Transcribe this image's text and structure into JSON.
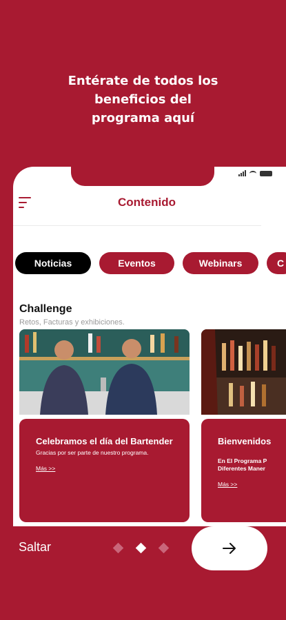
{
  "onboarding": {
    "headline_lines": [
      "Entérate de todos los",
      "beneficios del",
      "programa aquí"
    ],
    "skip_label": "Saltar",
    "current_page": 2,
    "total_pages": 3
  },
  "app": {
    "title": "Contenido",
    "tabs": [
      {
        "label": "Noticias",
        "active": true
      },
      {
        "label": "Eventos",
        "active": false
      },
      {
        "label": "Webinars",
        "active": false
      },
      {
        "label": "C",
        "active": false
      }
    ],
    "section": {
      "title": "Challenge",
      "subtitle": "Retos, Facturas y exhibiciones."
    },
    "cards": [
      {
        "title": "Celebramos el día del Bartender",
        "text": "Gracias por ser parte de nuestro programa.",
        "link": "Más >>"
      },
      {
        "title": "Bienvenidos",
        "text": "En El Programa P Diferentes Maner",
        "link": "Más >>"
      }
    ]
  },
  "colors": {
    "brand": "#a81a31",
    "active_tab": "#000000",
    "background": "#ffffff"
  }
}
